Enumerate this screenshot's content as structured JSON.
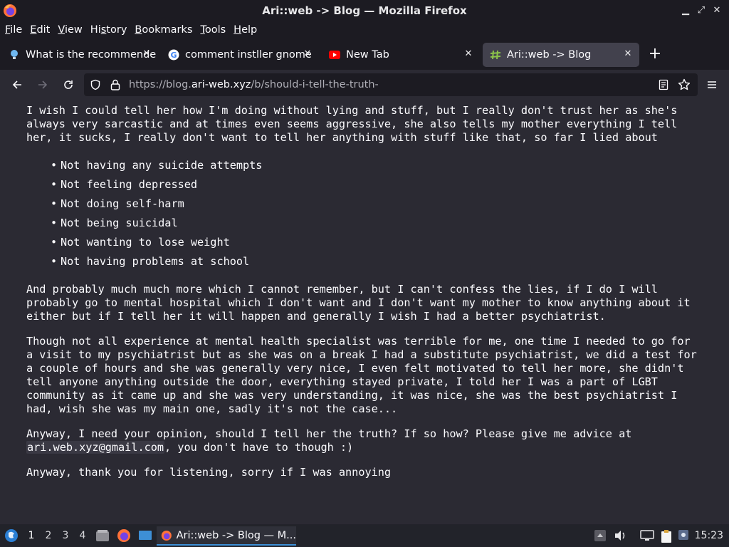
{
  "window": {
    "title": "Ari::web -> Blog — Mozilla Firefox"
  },
  "menubar": {
    "items": [
      {
        "label": "File",
        "accel": "F",
        "rest": "ile"
      },
      {
        "label": "Edit",
        "accel": "E",
        "rest": "dit"
      },
      {
        "label": "View",
        "accel": "V",
        "rest": "iew"
      },
      {
        "label": "History",
        "accel": "s",
        "pre": "Hi",
        "rest": "tory"
      },
      {
        "label": "Bookmarks",
        "accel": "B",
        "rest": "ookmarks"
      },
      {
        "label": "Tools",
        "accel": "T",
        "rest": "ools"
      },
      {
        "label": "Help",
        "accel": "H",
        "rest": "elp"
      }
    ]
  },
  "tabs": [
    {
      "label": "What is the recommende",
      "icon": "lightbulb-icon",
      "active": false
    },
    {
      "label": "comment instller gnome",
      "icon": "google-icon",
      "active": false
    },
    {
      "label": "New Tab",
      "icon": "youtube-icon",
      "active": false
    },
    {
      "label": "Ari::web -> Blog",
      "icon": "hash-icon",
      "active": true
    }
  ],
  "navbar": {
    "url_prefix": "https://blog.",
    "url_domain": "ari-web.xyz",
    "url_path": "/b/should-i-tell-the-truth-"
  },
  "article": {
    "intro": "I wish I could tell her how I'm doing without lying and stuff, but I really don't trust her as she's always very sarcastic and at times even seems aggressive, she also tells my mother everything I tell her, it sucks, I really don't want to tell her anything with stuff like that, so far I lied about",
    "lies": [
      "Not having any suicide attempts",
      "Not feeling depressed",
      "Not doing self-harm",
      "Not being suicidal",
      "Not wanting to lose weight",
      "Not having problems at school"
    ],
    "para2": "And probably much much more which I cannot remember, but I can't confess the lies, if I do I will probably go to mental hospital which I don't want and I don't want my mother to know anything about it either but if I tell her it will happen and generally I wish I had a better psychiatrist.",
    "para3": "Though not all experience at mental health specialist was terrible for me, one time I needed to go for a visit to my psychiatrist but as she was on a break I had a substitute psychiatrist, we did a test for a couple of hours and she was generally very nice, I even felt motivated to tell her more, she didn't tell anyone anything outside the door, everything stayed private, I told her I was a part of LGBT community as it came up and she was very understanding, it was nice, she was the best psychiatrist I had, wish she was my main one, sadly it's not the case...",
    "para4_before": "Anyway, I need your opinion, should I tell her the truth? If so how? Please give me advice at ",
    "para4_email": "ari.web.xyz@gmail.com",
    "para4_after": ", you don't have to though :)",
    "para5": "Anyway, thank you for listening, sorry if I was annoying"
  },
  "taskbar": {
    "workspaces": [
      "1",
      "2",
      "3",
      "4"
    ],
    "active_workspace": "1",
    "task_label": "Ari::web -> Blog — M...",
    "clock": "15:23"
  }
}
